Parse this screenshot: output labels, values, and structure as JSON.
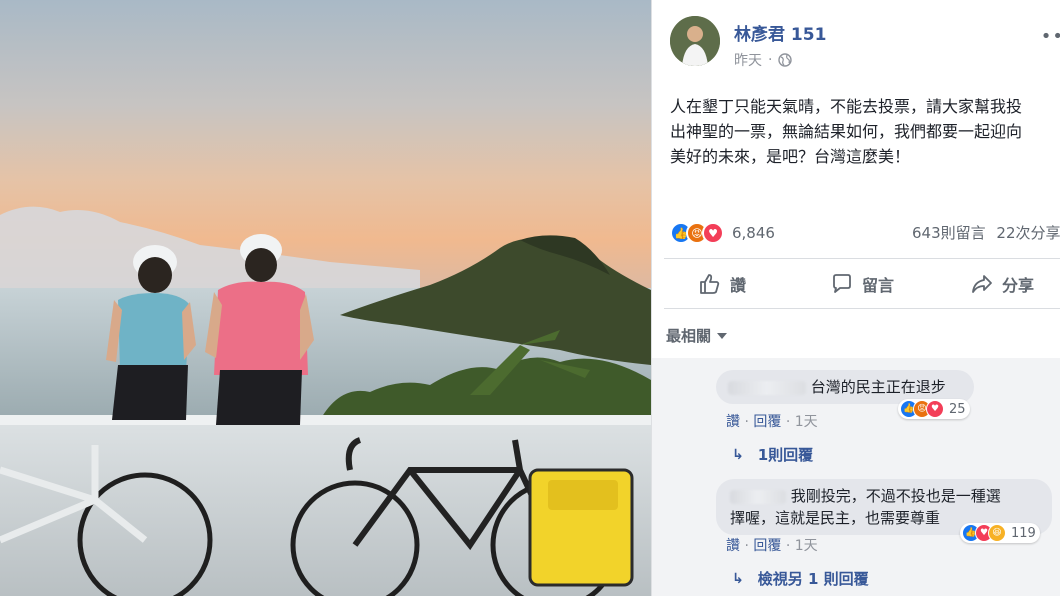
{
  "post": {
    "author": "林彥君 151",
    "time": "昨天",
    "text_lines": [
      "人在墾丁只能天氣晴，不能去投票，請大家幫我投",
      "出神聖的一票，無論結果如何，我們都要一起迎向",
      "美好的未來，是吧？台灣這麼美！"
    ],
    "reaction_count": "6,846",
    "comments_count": "643則留言",
    "shares_count": "22次分享"
  },
  "actions": {
    "like": "讚",
    "comment": "留言",
    "share": "分享"
  },
  "sort_label": "最相關",
  "comments": [
    {
      "text": "台灣的民主正在退步",
      "reaction_count": "25",
      "like_label": "讚",
      "reply_label": "回覆",
      "time": "1天",
      "replies_link": "1則回覆"
    },
    {
      "text_line1": "我剛投完，不過不投也是一種選",
      "text_line2": "擇喔，這就是民主，也需要尊重",
      "reaction_count": "119",
      "like_label": "讚",
      "reply_label": "回覆",
      "time": "1天",
      "replies_link": "檢視另 1 則回覆"
    }
  ],
  "colors": {
    "link": "#385898",
    "like": "#1877f2",
    "angry": "#e9710f",
    "love": "#f33e58",
    "haha": "#f7b125"
  }
}
